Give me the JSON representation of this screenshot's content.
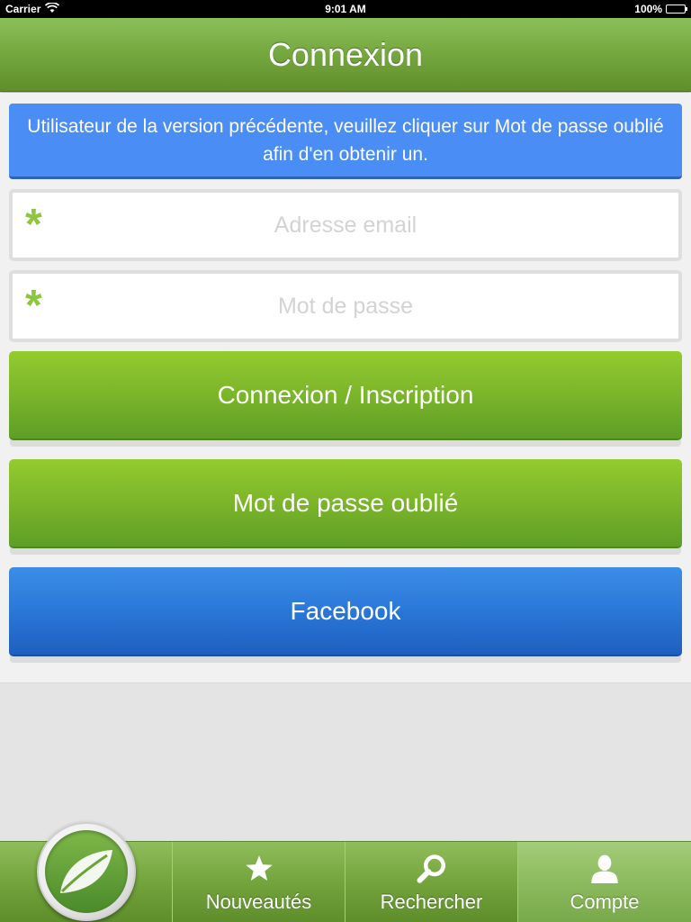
{
  "status_bar": {
    "carrier": "Carrier",
    "time": "9:01 AM",
    "battery_text": "100%",
    "battery_level": 1.0
  },
  "nav": {
    "title": "Connexion"
  },
  "info_banner": {
    "text": "Utilisateur de la version précédente, veuillez cliquer sur Mot de passe oublié afin d'en obtenir un."
  },
  "form": {
    "email": {
      "value": "",
      "placeholder": "Adresse email",
      "required_mark": "*"
    },
    "password": {
      "value": "",
      "placeholder": "Mot de passe",
      "required_mark": "*"
    }
  },
  "buttons": {
    "login": "Connexion / Inscription",
    "forgot": "Mot de passe oublié",
    "facebook": "Facebook"
  },
  "tabs": [
    {
      "label": "Nouveautés",
      "icon": "star-icon",
      "active": false
    },
    {
      "label": "Rechercher",
      "icon": "search-icon",
      "active": false
    },
    {
      "label": "Compte",
      "icon": "user-icon",
      "active": true
    }
  ],
  "colors": {
    "accent_green": "#7bb52a",
    "facebook_blue": "#2a77d8",
    "info_blue": "#4a8ef5",
    "required_green": "#8cc63f"
  }
}
